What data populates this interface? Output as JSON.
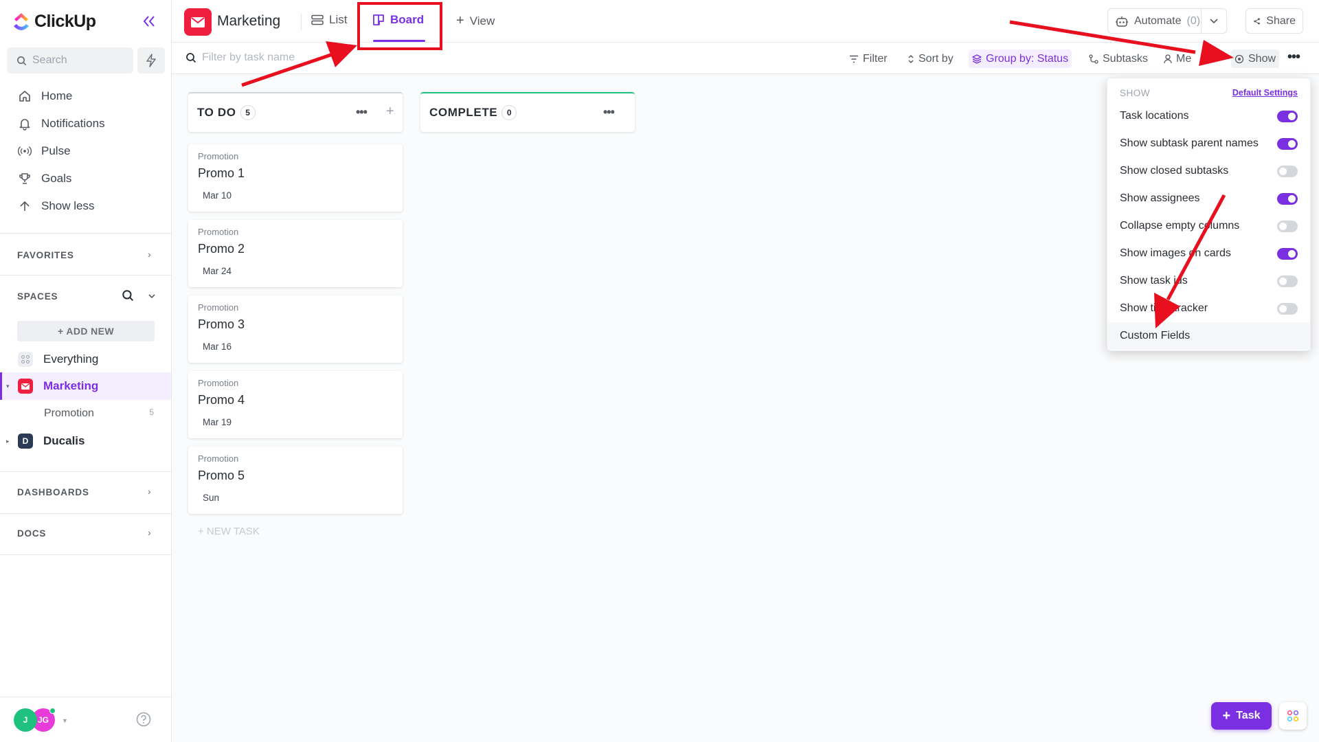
{
  "app": {
    "name": "ClickUp"
  },
  "sidebar": {
    "search_placeholder": "Search",
    "nav": [
      {
        "label": "Home",
        "icon": "home-icon"
      },
      {
        "label": "Notifications",
        "icon": "bell-icon"
      },
      {
        "label": "Pulse",
        "icon": "pulse-icon"
      },
      {
        "label": "Goals",
        "icon": "trophy-icon"
      },
      {
        "label": "Show less",
        "icon": "arrow-up-icon"
      }
    ],
    "favorites_label": "FAVORITES",
    "spaces_label": "SPACES",
    "add_new_label": "+ ADD NEW",
    "spaces": [
      {
        "label": "Everything"
      },
      {
        "label": "Marketing"
      },
      {
        "label": "Ducalis",
        "initial": "D"
      }
    ],
    "sub_list": {
      "label": "Promotion",
      "count": "5"
    },
    "dashboards_label": "DASHBOARDS",
    "docs_label": "DOCS",
    "avatars": [
      {
        "initial": "J",
        "color": "#1fc17f"
      },
      {
        "initial": "JG",
        "color": "#e73cd9"
      }
    ]
  },
  "header": {
    "space_title": "Marketing",
    "tabs": [
      {
        "label": "List"
      },
      {
        "label": "Board",
        "active": true
      },
      {
        "label": "View",
        "prefix": "+"
      }
    ],
    "automate_label": "Automate",
    "automate_count": "(0)",
    "share_label": "Share"
  },
  "filterbar": {
    "search_placeholder": "Filter by task name",
    "filter_label": "Filter",
    "sort_label": "Sort by",
    "group_label": "Group by: Status",
    "subtasks_label": "Subtasks",
    "me_label": "Me",
    "show_label": "Show"
  },
  "board": {
    "columns": [
      {
        "title": "TO DO",
        "count": "5",
        "accent": "#d3d5da",
        "cards": [
          {
            "crumb": "Promotion",
            "name": "Promo 1",
            "date": "Mar 10"
          },
          {
            "crumb": "Promotion",
            "name": "Promo 2",
            "date": "Mar 24"
          },
          {
            "crumb": "Promotion",
            "name": "Promo 3",
            "date": "Mar 16"
          },
          {
            "crumb": "Promotion",
            "name": "Promo 4",
            "date": "Mar 19"
          },
          {
            "crumb": "Promotion",
            "name": "Promo 5",
            "date": "Sun"
          }
        ]
      },
      {
        "title": "COMPLETE",
        "count": "0",
        "accent": "#1fc17f",
        "cards": []
      }
    ],
    "new_task_label": "+ NEW TASK"
  },
  "show_menu": {
    "heading": "SHOW",
    "default_settings_label": "Default Settings",
    "options": [
      {
        "label": "Task locations",
        "on": true
      },
      {
        "label": "Show subtask parent names",
        "on": true
      },
      {
        "label": "Show closed subtasks",
        "on": false
      },
      {
        "label": "Show assignees",
        "on": true
      },
      {
        "label": "Collapse empty columns",
        "on": false
      },
      {
        "label": "Show images on cards",
        "on": true
      },
      {
        "label": "Show task ids",
        "on": false
      },
      {
        "label": "Show time tracker",
        "on": false
      }
    ],
    "custom_fields_label": "Custom Fields"
  },
  "fab": {
    "task_label": "Task"
  },
  "colors": {
    "accent": "#7b2fe3",
    "brand_red": "#ee1f3f",
    "annotation": "#e8101e"
  }
}
